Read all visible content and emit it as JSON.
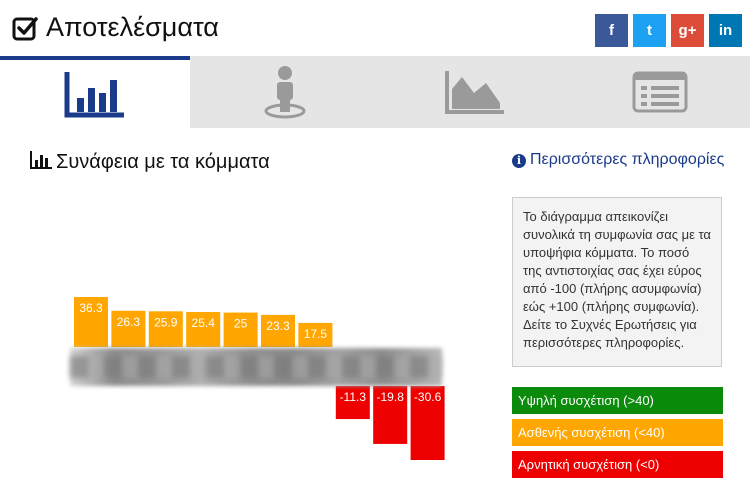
{
  "header": {
    "title": "Αποτελέσματα",
    "social": [
      {
        "name": "facebook",
        "glyph": "f",
        "color": "#3b5998"
      },
      {
        "name": "twitter",
        "glyph": "t",
        "color": "#1da1f2"
      },
      {
        "name": "google-plus",
        "glyph": "g+",
        "color": "#dd4b39"
      },
      {
        "name": "linkedin",
        "glyph": "in",
        "color": "#0077b5"
      }
    ]
  },
  "tabs": [
    {
      "icon": "bar-chart-icon",
      "active": true
    },
    {
      "icon": "person-pin-icon",
      "active": false
    },
    {
      "icon": "area-chart-icon",
      "active": false
    },
    {
      "icon": "list-icon",
      "active": false
    }
  ],
  "colors": {
    "accent": "#1a3a8a",
    "high": "#0b8a0b",
    "weak": "#ffa600",
    "negative": "#ee0000"
  },
  "chart_data": {
    "type": "bar",
    "title": "Συνάφεια με τα κόμματα",
    "values": [
      36.3,
      26.3,
      25.9,
      25.4,
      25,
      23.3,
      17.5,
      -11.3,
      -19.8,
      -30.6
    ],
    "data_labels": [
      "36.3",
      "26.3",
      "25.9",
      "25.4",
      "25",
      "23.3",
      "17.5",
      "-11.3",
      "-19.8",
      "-30.6"
    ],
    "categories_obscured": true
  },
  "info": {
    "heading": "Περισσότερες πληροφορίες",
    "text": "Το διάγραμμα απεικονίζει συνολικά τη συμφωνία σας με τα υποψήφια κόμματα. Το ποσό της αντιστοιχίας σας έχει εύρος από -100 (πλήρης ασυμφωνία) εώς +100 (πλήρης συμφωνία). Δείτε το Συχνές Ερωτήσεις για περισσότερες πληροφορίες."
  },
  "legend": {
    "high": "Υψηλή συσχέτιση (>40)",
    "weak": "Ασθενής συσχέτιση (<40)",
    "negative": "Αρνητική συσχέτιση (<0)"
  }
}
